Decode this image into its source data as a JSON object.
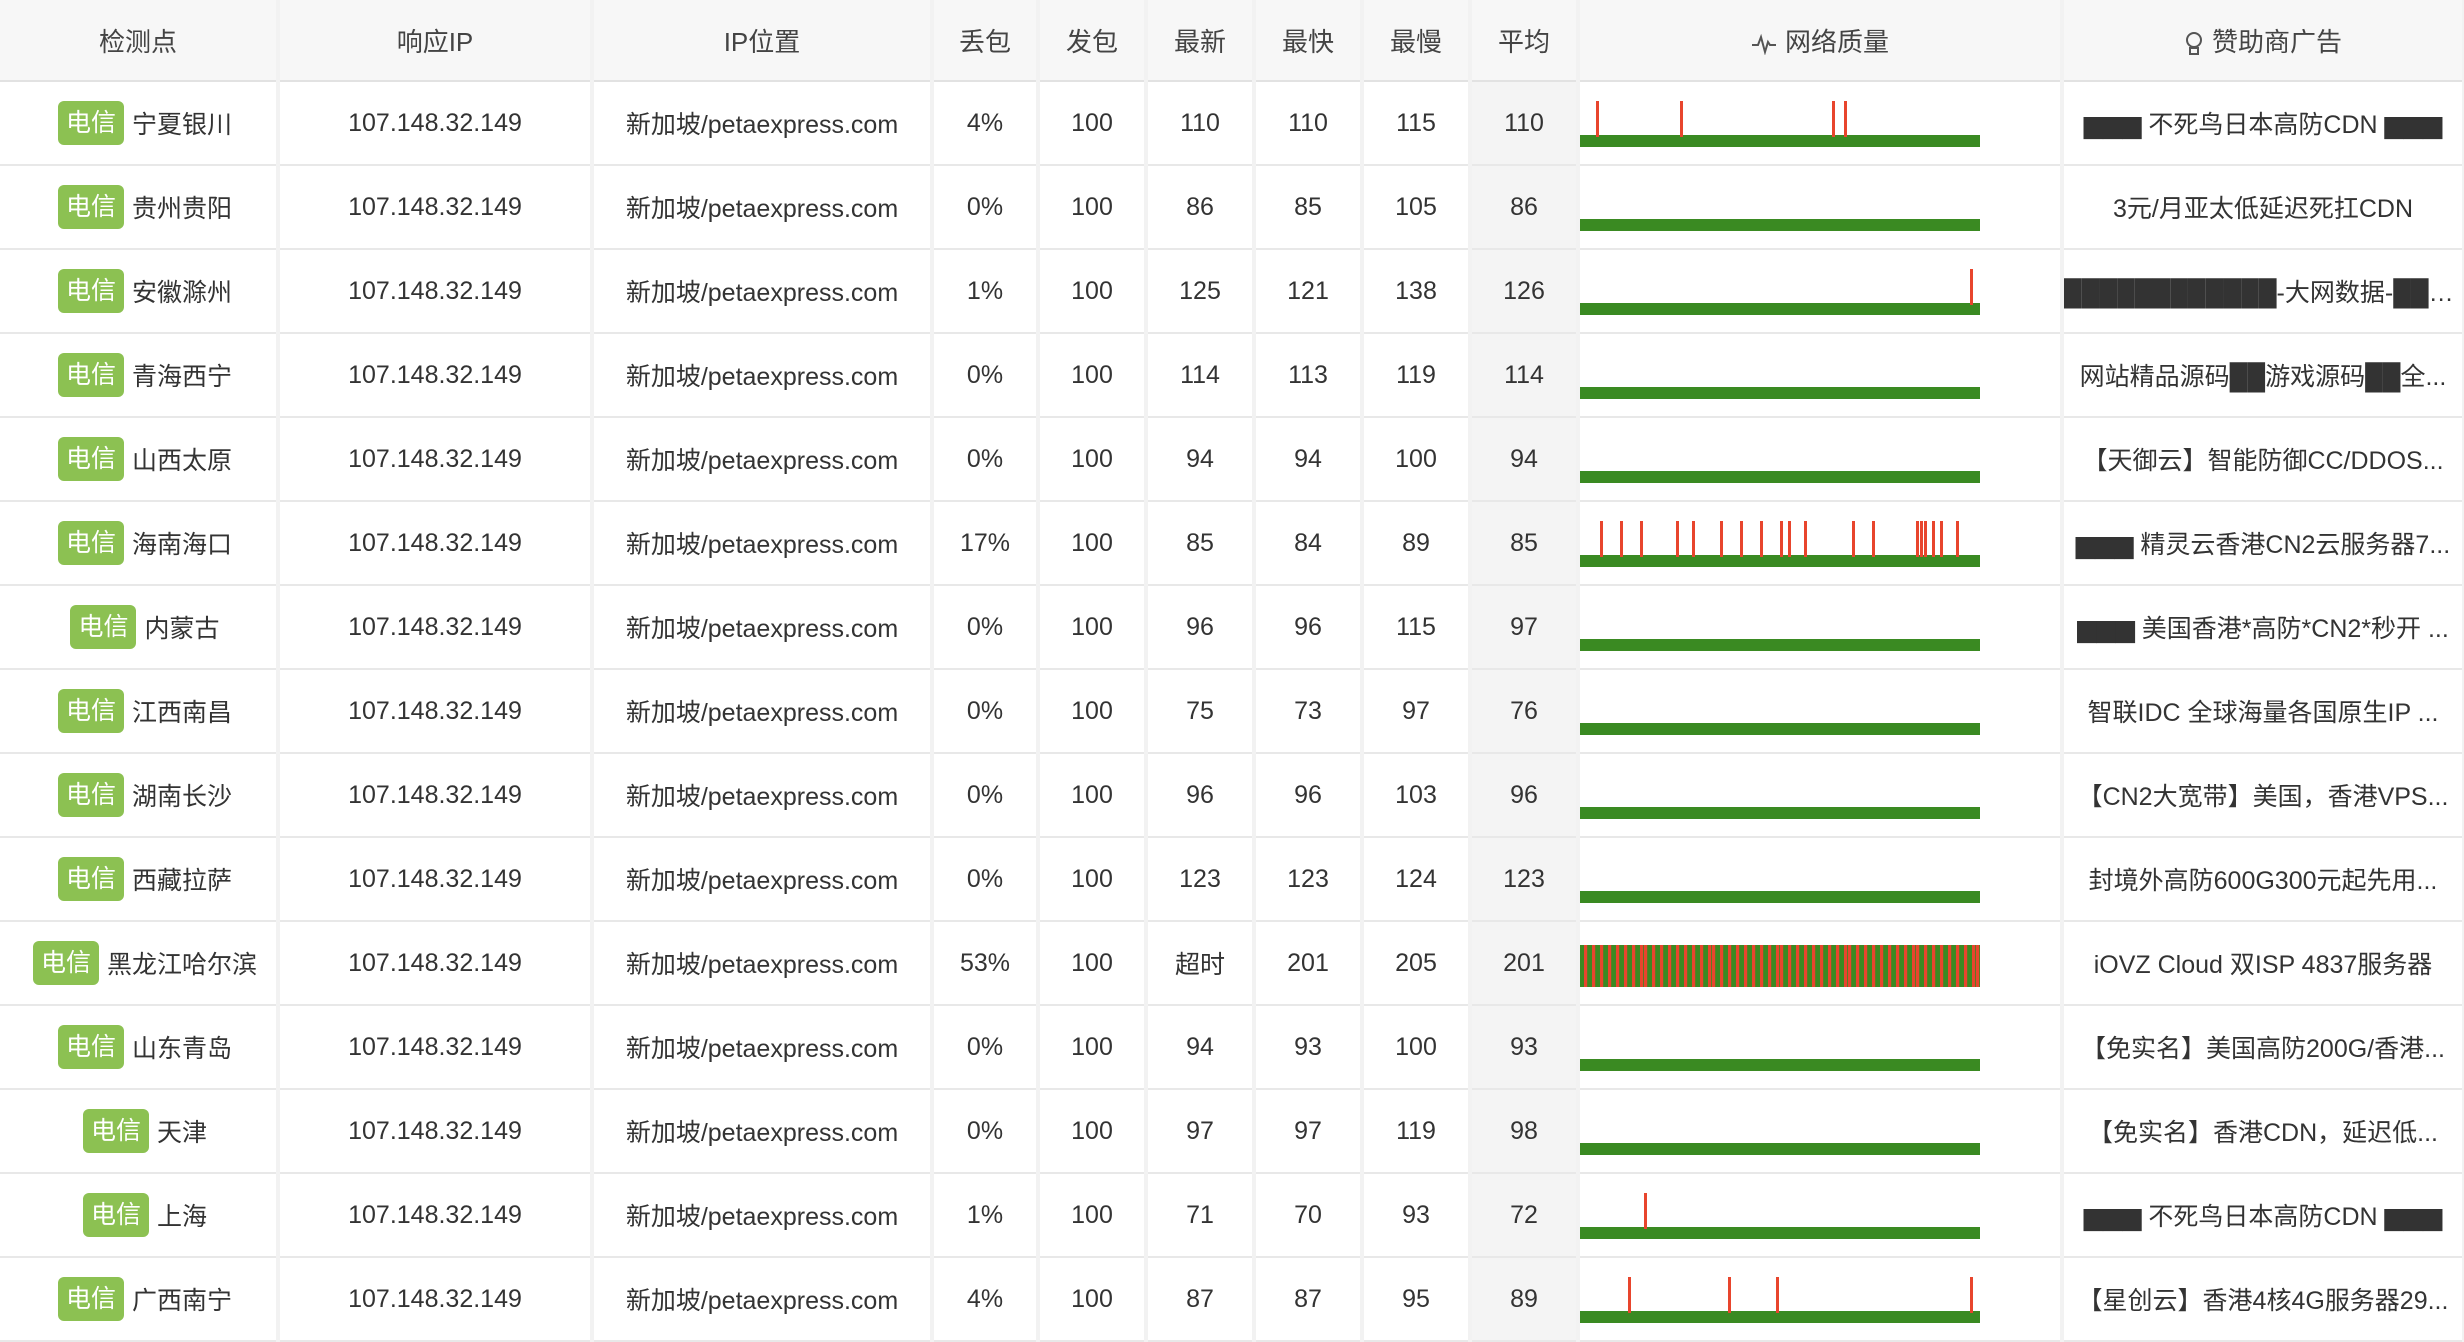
{
  "headers": {
    "node": "检测点",
    "ip": "响应IP",
    "location": "IP位置",
    "loss": "丢包",
    "sent": "发包",
    "latest": "最新",
    "fastest": "最快",
    "slowest": "最慢",
    "average": "平均",
    "quality": "网络质量",
    "sponsor": "赞助商广告"
  },
  "colors": {
    "badge": "#8cc152",
    "bar_ok": "#3a8a22",
    "bar_loss": "#e8452d",
    "timeout_text": "#e8452d"
  },
  "icons": {
    "quality": "pulse-icon",
    "sponsor": "lightbulb-icon"
  },
  "rows": [
    {
      "isp": "电信",
      "node": "宁夏银川",
      "ip": "107.148.32.149",
      "location": "新加坡/petaexpress.com",
      "loss": "4%",
      "sent": "100",
      "latest": "110",
      "fastest": "110",
      "slowest": "115",
      "average": "110",
      "ad": "▆▆▆ 不死鸟日本高防CDN ▆▆▆",
      "loss_fraction": 0.04,
      "spikes": [
        0.04,
        0.25,
        0.63,
        0.66
      ],
      "timeout": false
    },
    {
      "isp": "电信",
      "node": "贵州贵阳",
      "ip": "107.148.32.149",
      "location": "新加坡/petaexpress.com",
      "loss": "0%",
      "sent": "100",
      "latest": "86",
      "fastest": "85",
      "slowest": "105",
      "average": "86",
      "ad": "3元/月亚太低延迟死扛CDN",
      "loss_fraction": 0,
      "spikes": [],
      "timeout": false
    },
    {
      "isp": "电信",
      "node": "安徽滁州",
      "ip": "107.148.32.149",
      "location": "新加坡/petaexpress.com",
      "loss": "1%",
      "sent": "100",
      "latest": "125",
      "fastest": "121",
      "slowest": "138",
      "average": "126",
      "ad": "████████████-大网数据-███...",
      "loss_fraction": 0.01,
      "spikes": [
        0.975
      ],
      "timeout": false
    },
    {
      "isp": "电信",
      "node": "青海西宁",
      "ip": "107.148.32.149",
      "location": "新加坡/petaexpress.com",
      "loss": "0%",
      "sent": "100",
      "latest": "114",
      "fastest": "113",
      "slowest": "119",
      "average": "114",
      "ad": "网站精品源码██游戏源码██全...",
      "loss_fraction": 0,
      "spikes": [],
      "timeout": false
    },
    {
      "isp": "电信",
      "node": "山西太原",
      "ip": "107.148.32.149",
      "location": "新加坡/petaexpress.com",
      "loss": "0%",
      "sent": "100",
      "latest": "94",
      "fastest": "94",
      "slowest": "100",
      "average": "94",
      "ad": "【天御云】智能防御CC/DDOS...",
      "loss_fraction": 0,
      "spikes": [],
      "timeout": false
    },
    {
      "isp": "电信",
      "node": "海南海口",
      "ip": "107.148.32.149",
      "location": "新加坡/petaexpress.com",
      "loss": "17%",
      "sent": "100",
      "latest": "85",
      "fastest": "84",
      "slowest": "89",
      "average": "85",
      "ad": "▆▆▆ 精灵云香港CN2云服务器7...",
      "loss_fraction": 0.17,
      "spikes": [
        0.05,
        0.1,
        0.15,
        0.24,
        0.28,
        0.35,
        0.4,
        0.45,
        0.5,
        0.52,
        0.56,
        0.68,
        0.73,
        0.84,
        0.85,
        0.86,
        0.88,
        0.9,
        0.94
      ],
      "timeout": false
    },
    {
      "isp": "电信",
      "node": "内蒙古",
      "ip": "107.148.32.149",
      "location": "新加坡/petaexpress.com",
      "loss": "0%",
      "sent": "100",
      "latest": "96",
      "fastest": "96",
      "slowest": "115",
      "average": "97",
      "ad": "▆▆▆ 美国香港*高防*CN2*秒开 ...",
      "loss_fraction": 0,
      "spikes": [],
      "timeout": false
    },
    {
      "isp": "电信",
      "node": "江西南昌",
      "ip": "107.148.32.149",
      "location": "新加坡/petaexpress.com",
      "loss": "0%",
      "sent": "100",
      "latest": "75",
      "fastest": "73",
      "slowest": "97",
      "average": "76",
      "ad": "智联IDC 全球海量各国原生IP ...",
      "loss_fraction": 0,
      "spikes": [],
      "timeout": false
    },
    {
      "isp": "电信",
      "node": "湖南长沙",
      "ip": "107.148.32.149",
      "location": "新加坡/petaexpress.com",
      "loss": "0%",
      "sent": "100",
      "latest": "96",
      "fastest": "96",
      "slowest": "103",
      "average": "96",
      "ad": "【CN2大宽带】美国，香港VPS...",
      "loss_fraction": 0,
      "spikes": [],
      "timeout": false
    },
    {
      "isp": "电信",
      "node": "西藏拉萨",
      "ip": "107.148.32.149",
      "location": "新加坡/petaexpress.com",
      "loss": "0%",
      "sent": "100",
      "latest": "123",
      "fastest": "123",
      "slowest": "124",
      "average": "123",
      "ad": "封境外高防600G300元起先用...",
      "loss_fraction": 0,
      "spikes": [],
      "timeout": false
    },
    {
      "isp": "电信",
      "node": "黑龙江哈尔滨",
      "ip": "107.148.32.149",
      "location": "新加坡/petaexpress.com",
      "loss": "53%",
      "sent": "100",
      "latest": "超时",
      "fastest": "201",
      "slowest": "205",
      "average": "201",
      "ad": "iOVZ Cloud 双ISP 4837服务器",
      "loss_fraction": 0.53,
      "spikes": [],
      "timeout": true
    },
    {
      "isp": "电信",
      "node": "山东青岛",
      "ip": "107.148.32.149",
      "location": "新加坡/petaexpress.com",
      "loss": "0%",
      "sent": "100",
      "latest": "94",
      "fastest": "93",
      "slowest": "100",
      "average": "93",
      "ad": "【免实名】美国高防200G/香港...",
      "loss_fraction": 0,
      "spikes": [],
      "timeout": false
    },
    {
      "isp": "电信",
      "node": "天津",
      "ip": "107.148.32.149",
      "location": "新加坡/petaexpress.com",
      "loss": "0%",
      "sent": "100",
      "latest": "97",
      "fastest": "97",
      "slowest": "119",
      "average": "98",
      "ad": "【免实名】香港CDN，延迟低...",
      "loss_fraction": 0,
      "spikes": [],
      "timeout": false
    },
    {
      "isp": "电信",
      "node": "上海",
      "ip": "107.148.32.149",
      "location": "新加坡/petaexpress.com",
      "loss": "1%",
      "sent": "100",
      "latest": "71",
      "fastest": "70",
      "slowest": "93",
      "average": "72",
      "ad": "▆▆▆ 不死鸟日本高防CDN ▆▆▆",
      "loss_fraction": 0.01,
      "spikes": [
        0.16
      ],
      "timeout": false
    },
    {
      "isp": "电信",
      "node": "广西南宁",
      "ip": "107.148.32.149",
      "location": "新加坡/petaexpress.com",
      "loss": "4%",
      "sent": "100",
      "latest": "87",
      "fastest": "87",
      "slowest": "95",
      "average": "89",
      "ad": "【星创云】香港4核4G服务器29...",
      "loss_fraction": 0.04,
      "spikes": [
        0.12,
        0.37,
        0.49,
        0.975
      ],
      "timeout": false
    }
  ]
}
